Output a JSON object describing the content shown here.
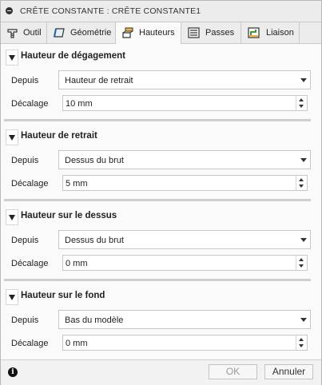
{
  "dialog": {
    "title": "CRÊTE CONSTANTE : CRÊTE CONSTANTE1"
  },
  "tabs": [
    {
      "label": "Outil",
      "icon": "tool-icon"
    },
    {
      "label": "Géométrie",
      "icon": "geometry-icon"
    },
    {
      "label": "Hauteurs",
      "icon": "heights-icon",
      "active": true
    },
    {
      "label": "Passes",
      "icon": "passes-icon"
    },
    {
      "label": "Liaison",
      "icon": "linking-icon"
    }
  ],
  "groups": [
    {
      "title": "Hauteur de dégagement",
      "from_label": "Depuis",
      "from_value": "Hauteur de retrait",
      "offset_label": "Décalage",
      "offset_value": "10 mm"
    },
    {
      "title": "Hauteur de retrait",
      "from_label": "Depuis",
      "from_value": "Dessus du brut",
      "offset_label": "Décalage",
      "offset_value": "5 mm"
    },
    {
      "title": "Hauteur sur le dessus",
      "from_label": "Depuis",
      "from_value": "Dessus du brut",
      "offset_label": "Décalage",
      "offset_value": "0 mm"
    },
    {
      "title": "Hauteur sur le fond",
      "from_label": "Depuis",
      "from_value": "Bas du modèle",
      "offset_label": "Décalage",
      "offset_value": "0 mm"
    }
  ],
  "footer": {
    "info_icon": "i",
    "ok_label": "OK",
    "cancel_label": "Annuler"
  }
}
